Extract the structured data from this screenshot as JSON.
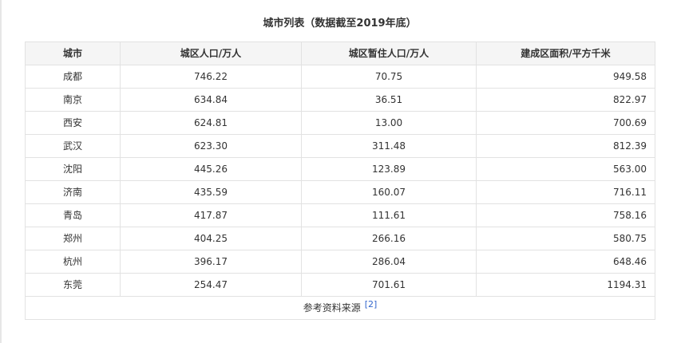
{
  "table": {
    "title": "城市列表（数据截至2019年底）",
    "headers": [
      "城市",
      "城区人口/万人",
      "城区暂住人口/万人",
      "建成区面积/平方千米"
    ],
    "rows": [
      [
        "成都",
        "746.22",
        "70.75",
        "949.58"
      ],
      [
        "南京",
        "634.84",
        "36.51",
        "822.97"
      ],
      [
        "西安",
        "624.81",
        "13.00",
        "700.69"
      ],
      [
        "武汉",
        "623.30",
        "311.48",
        "812.39"
      ],
      [
        "沈阳",
        "445.26",
        "123.89",
        "563.00"
      ],
      [
        "济南",
        "435.59",
        "160.07",
        "716.11"
      ],
      [
        "青岛",
        "417.87",
        "111.61",
        "758.16"
      ],
      [
        "郑州",
        "404.25",
        "266.16",
        "580.75"
      ],
      [
        "杭州",
        "396.17",
        "286.04",
        "648.46"
      ],
      [
        "东莞",
        "254.47",
        "701.61",
        "1194.31"
      ]
    ],
    "footnote": "参考资料来源",
    "reference": "[2]"
  },
  "colors": {
    "header_bg": "#f5f5f5",
    "border": "#e2e2e2",
    "link": "#3366cc"
  }
}
